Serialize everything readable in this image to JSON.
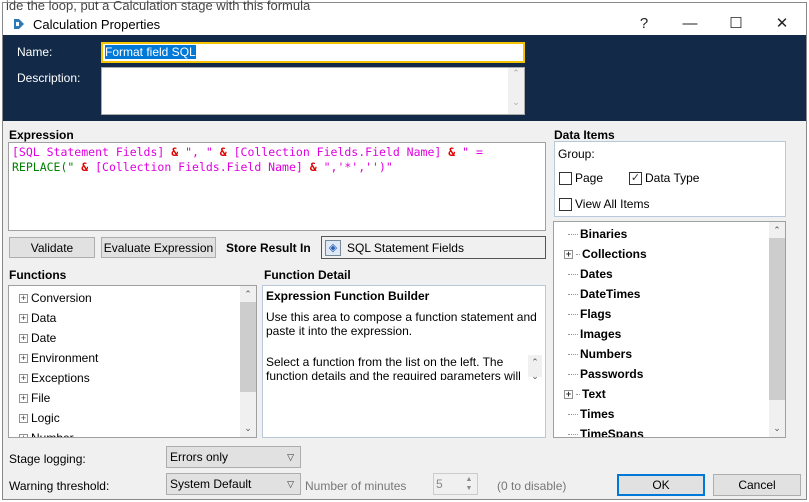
{
  "background_text": "ide the loop, put a Calculation stage with this formula",
  "window": {
    "title": "Calculation Properties",
    "help": "?",
    "minimize": "—",
    "maximize": "☐",
    "close": "✕"
  },
  "header": {
    "name_label": "Name:",
    "name_value": "Format field SQL",
    "description_label": "Description:",
    "description_value": ""
  },
  "expression": {
    "label": "Expression",
    "tokens_line1": [
      {
        "text": "[SQL Statement Fields]",
        "kind": "pink"
      },
      {
        "text": " & ",
        "kind": "red"
      },
      {
        "text": "\", \"",
        "kind": "pink"
      },
      {
        "text": " & ",
        "kind": "red"
      },
      {
        "text": "[Collection Fields.Field Name]",
        "kind": "pink"
      },
      {
        "text": " & ",
        "kind": "red"
      },
      {
        "text": "\" =",
        "kind": "pink"
      }
    ],
    "tokens_line2": [
      {
        "text": "REPLACE(\"",
        "kind": "green"
      },
      {
        "text": " & ",
        "kind": "red"
      },
      {
        "text": "[Collection Fields.Field Name]",
        "kind": "pink"
      },
      {
        "text": " & ",
        "kind": "red"
      },
      {
        "text": "\",'*','')\"",
        "kind": "pink"
      }
    ]
  },
  "toolbar": {
    "validate": "Validate",
    "evaluate": "Evaluate Expression",
    "store_label": "Store Result In",
    "store_value": "SQL Statement Fields"
  },
  "functions": {
    "label": "Functions",
    "items": [
      "Conversion",
      "Data",
      "Date",
      "Environment",
      "Exceptions",
      "File",
      "Logic",
      "Number"
    ]
  },
  "function_detail": {
    "label": "Function Detail",
    "heading": "Expression Function Builder",
    "text": "Use this area to compose a function statement and paste it into the expression.",
    "hint": "Select a function from the list on the left. The function details and the required parameters will"
  },
  "data_items": {
    "label": "Data Items",
    "group_label": "Group:",
    "page": {
      "label": "Page",
      "checked": false
    },
    "data_type": {
      "label": "Data Type",
      "checked": true
    },
    "view_all": {
      "label": "View All Items",
      "checked": false
    },
    "items": [
      {
        "label": "Binaries",
        "expandable": false
      },
      {
        "label": "Collections",
        "expandable": true
      },
      {
        "label": "Dates",
        "expandable": false
      },
      {
        "label": "DateTimes",
        "expandable": false
      },
      {
        "label": "Flags",
        "expandable": false
      },
      {
        "label": "Images",
        "expandable": false
      },
      {
        "label": "Numbers",
        "expandable": false
      },
      {
        "label": "Passwords",
        "expandable": false
      },
      {
        "label": "Text",
        "expandable": true
      },
      {
        "label": "Times",
        "expandable": false
      },
      {
        "label": "TimeSpans",
        "expandable": false
      }
    ]
  },
  "footer": {
    "stage_logging_label": "Stage logging:",
    "stage_logging_value": "Errors only",
    "warning_label": "Warning threshold:",
    "warning_value": "System Default",
    "minutes_label": "Number of minutes",
    "minutes_value": "5",
    "disable_hint": "(0 to disable)",
    "ok": "OK",
    "cancel": "Cancel"
  },
  "colors": {
    "header_bg": "#122a47",
    "focus": "#f5c400",
    "selection": "#0078d7",
    "ok_border": "#0078d7"
  }
}
